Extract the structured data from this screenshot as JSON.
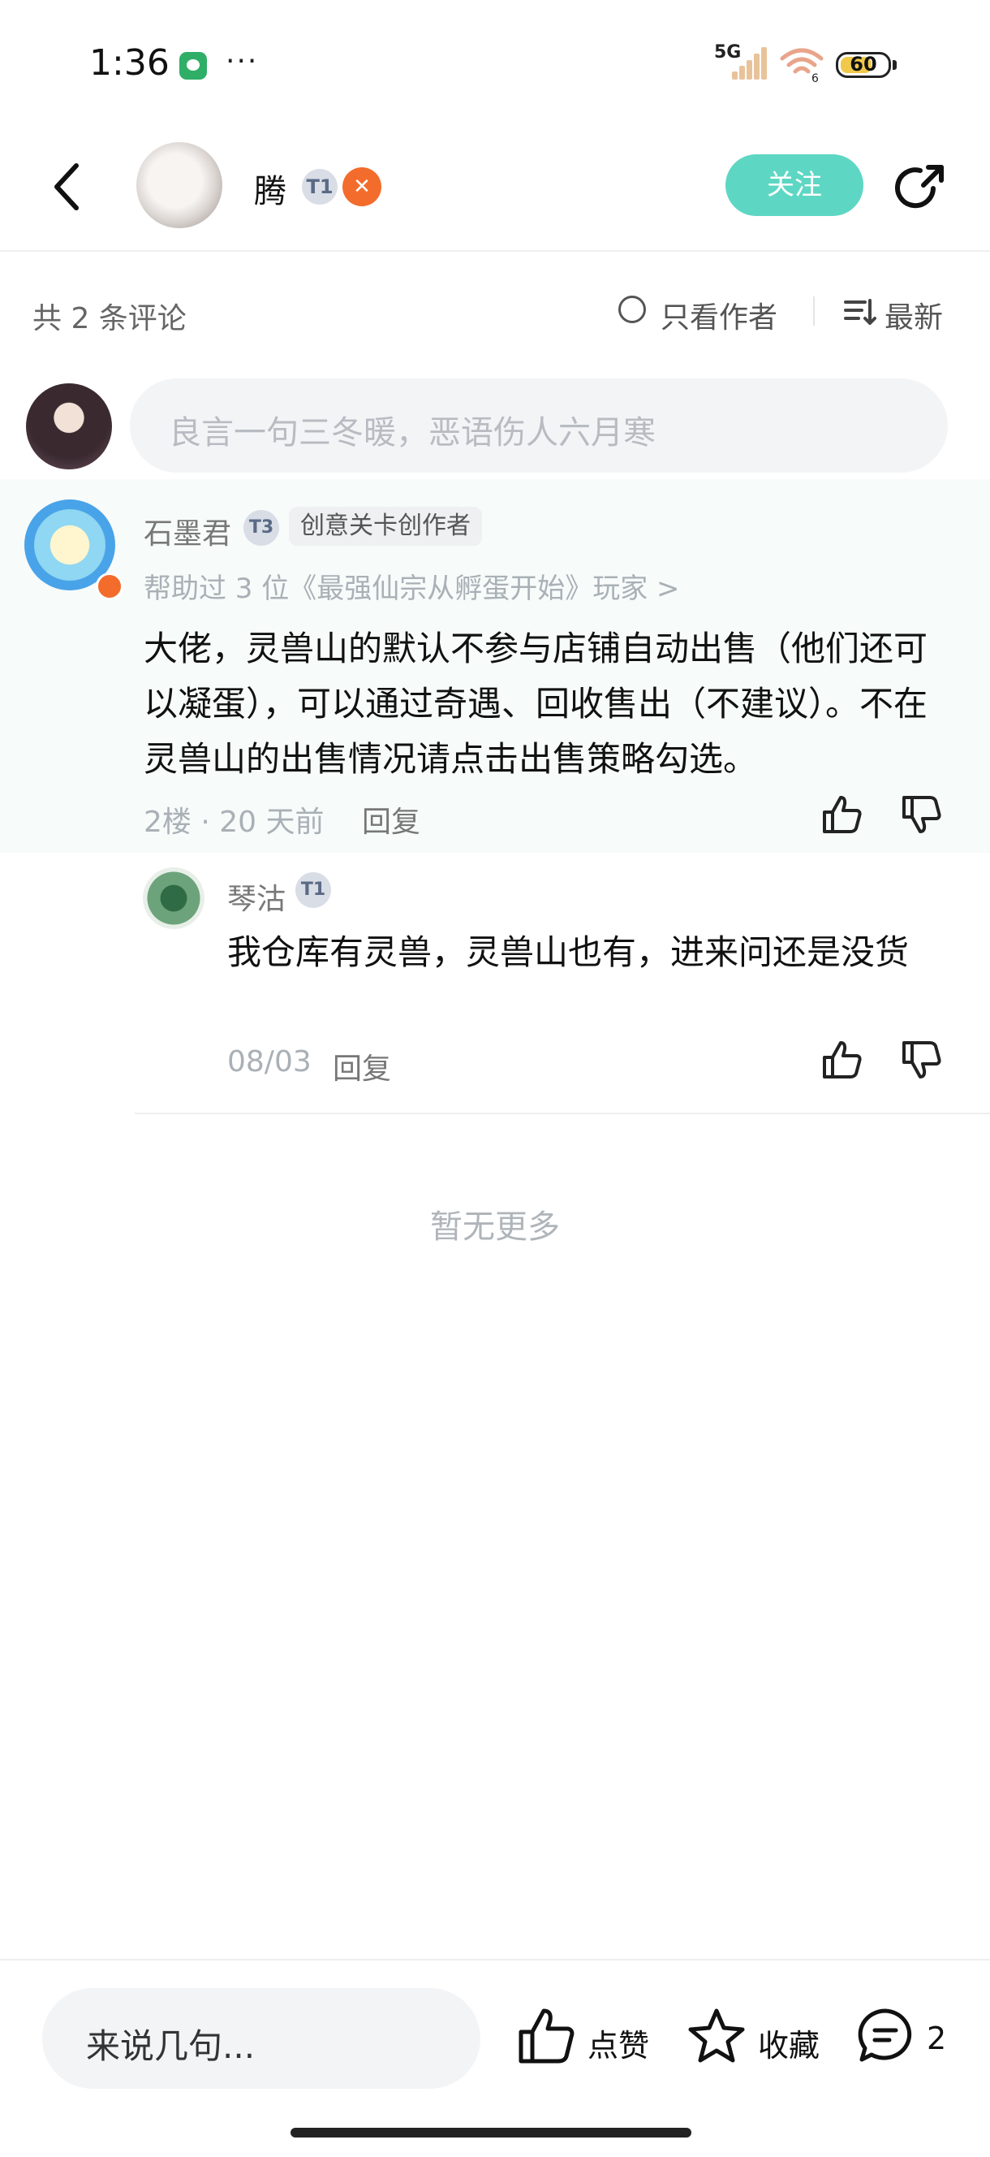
{
  "status_bar": {
    "time": "1:36",
    "dots": "···",
    "network": "5G",
    "battery": "60"
  },
  "header": {
    "username": "腾",
    "badge_level": "T1",
    "follow_label": "关注"
  },
  "filter": {
    "total_label": "共 2 条评论",
    "author_only_label": "只看作者",
    "sort_label": "最新"
  },
  "comment_input": {
    "placeholder": "良言一句三冬暖，恶语伤人六月寒"
  },
  "comments": [
    {
      "author": "石墨君",
      "level": "T3",
      "tag": "创意关卡创作者",
      "help_text": "帮助过 3 位《最强仙宗从孵蛋开始》玩家 >",
      "text": "大佬，灵兽山的默认不参与店铺自动出售（他们还可以凝蛋），可以通过奇遇、回收售出（不建议）。不在灵兽山的出售情况请点击出售策略勾选。",
      "meta": "2楼 · 20 天前",
      "reply_label": "回复",
      "replies": [
        {
          "author": "琴沽",
          "level": "T1",
          "text": "我仓库有灵兽，灵兽山也有，进来问还是没货",
          "date": "08/03",
          "reply_label": "回复"
        }
      ]
    }
  ],
  "list_end": "暂无更多",
  "bottom_bar": {
    "input_placeholder": "来说几句...",
    "like_label": "点赞",
    "favorite_label": "收藏",
    "comment_count": "2"
  },
  "colors": {
    "accent": "#5dd7c3",
    "badge_orange": "#f36c2b",
    "muted_text": "#a9b0b6"
  },
  "icons": [
    "wechat-icon",
    "back-icon",
    "share-icon",
    "sort-icon",
    "thumbs-up-icon",
    "thumbs-down-icon",
    "star-icon",
    "comment-icon"
  ]
}
